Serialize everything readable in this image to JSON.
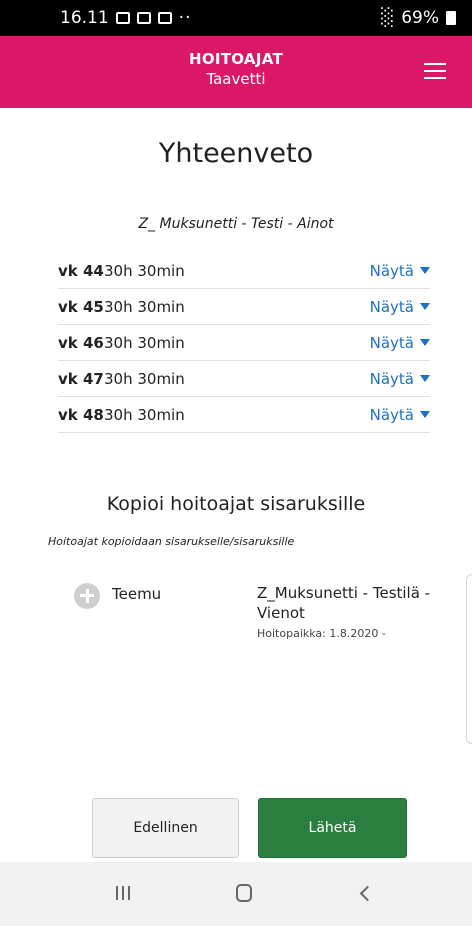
{
  "status_bar": {
    "time": "16.11",
    "battery": "69%"
  },
  "header": {
    "title": "HOITOAJAT",
    "subtitle": "Taavetti"
  },
  "summary": {
    "title": "Yhteenveto",
    "child_name": "Z_ Muksunetti - Testi - Ainot",
    "weeks": [
      {
        "week": "vk 44",
        "hours": "30h 30min",
        "action": "Näytä"
      },
      {
        "week": "vk 45",
        "hours": "30h 30min",
        "action": "Näytä"
      },
      {
        "week": "vk 46",
        "hours": "30h 30min",
        "action": "Näytä"
      },
      {
        "week": "vk 47",
        "hours": "30h 30min",
        "action": "Näytä"
      },
      {
        "week": "vk 48",
        "hours": "30h 30min",
        "action": "Näytä"
      }
    ]
  },
  "copy_section": {
    "title": "Kopioi hoitoajat sisaruksille",
    "description": "Hoitoajat kopioidaan sisarukselle/sisaruksille",
    "siblings": [
      {
        "name": "Teemu",
        "place": "Z_Muksunetti - Testilä - Vienot",
        "care_period": "Hoitopaikka: 1.8.2020 -"
      }
    ]
  },
  "footer": {
    "previous_label": "Edellinen",
    "send_label": "Lähetä"
  },
  "colors": {
    "header": "#db1868",
    "link": "#1d6fc4",
    "send_button": "#2a7f3e"
  },
  "icons": [
    "menu-icon",
    "chevron-down-icon",
    "plus-circle-icon",
    "recent-apps-icon",
    "home-icon",
    "back-icon"
  ]
}
